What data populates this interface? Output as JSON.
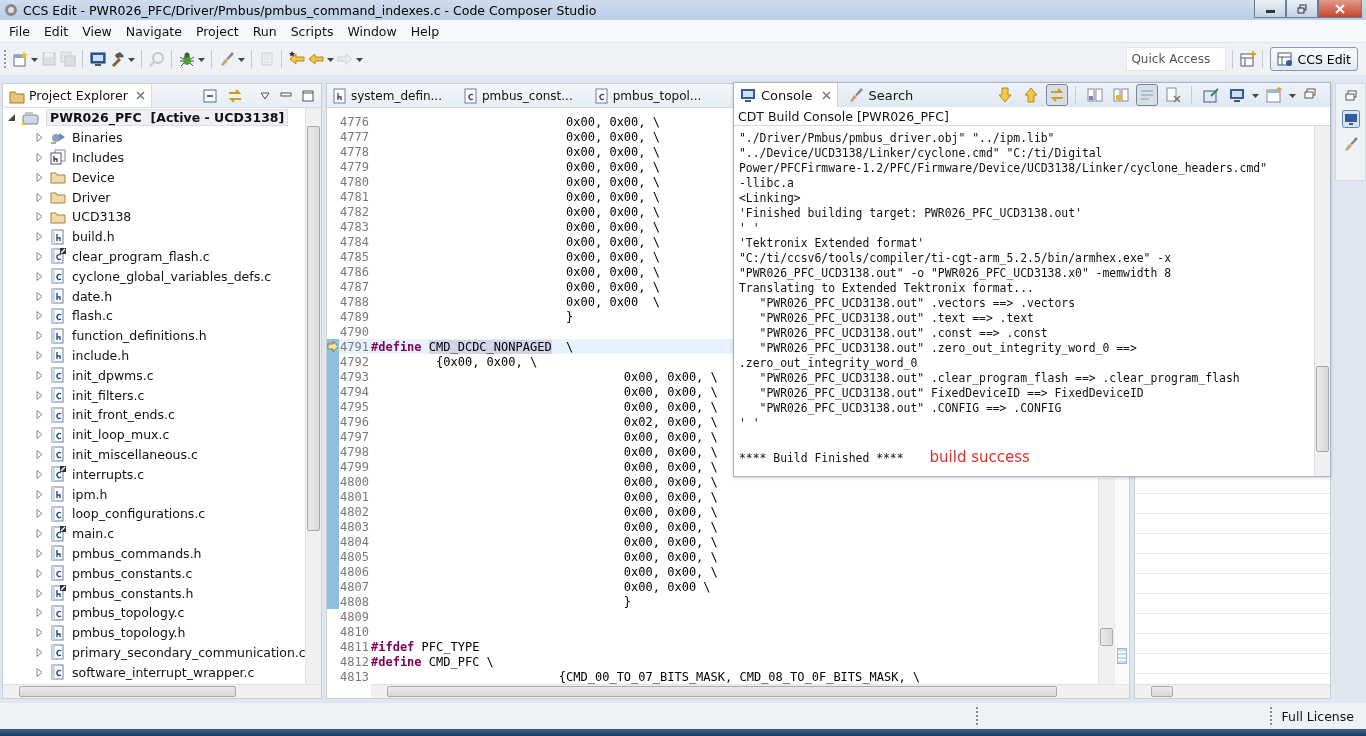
{
  "window": {
    "title": "CCS Edit - PWR026_PFC/Driver/Pmbus/pmbus_command_indexes.c - Code Composer Studio"
  },
  "menu": [
    "File",
    "Edit",
    "View",
    "Navigate",
    "Project",
    "Run",
    "Scripts",
    "Window",
    "Help"
  ],
  "toolbar": {
    "items": [
      {
        "kind": "new",
        "disabled": false,
        "dropdown": true
      },
      {
        "kind": "save",
        "disabled": true,
        "dropdown": false
      },
      {
        "kind": "save-all",
        "disabled": true,
        "dropdown": false
      },
      {
        "kind": "sep"
      },
      {
        "kind": "monitor",
        "disabled": false,
        "dropdown": false
      },
      {
        "kind": "hammer",
        "disabled": false,
        "dropdown": true
      },
      {
        "kind": "sep"
      },
      {
        "kind": "search",
        "disabled": true,
        "dropdown": false
      },
      {
        "kind": "sep"
      },
      {
        "kind": "bug",
        "disabled": false,
        "dropdown": true
      },
      {
        "kind": "sep"
      },
      {
        "kind": "brush",
        "disabled": false,
        "dropdown": true
      },
      {
        "kind": "sep"
      },
      {
        "kind": "page",
        "disabled": true,
        "dropdown": false
      },
      {
        "kind": "sep"
      },
      {
        "kind": "last-edit",
        "disabled": false,
        "dropdown": false
      },
      {
        "kind": "back",
        "disabled": false,
        "dropdown": true
      },
      {
        "kind": "forward",
        "disabled": true,
        "dropdown": true
      }
    ],
    "quick_access": {
      "placeholder": "Quick Access"
    },
    "perspective": {
      "label": "CCS Edit",
      "selected": true
    }
  },
  "project_explorer": {
    "title": "Project Explorer",
    "tree": {
      "label": "PWR026_PFC  [Active - UCD3138]",
      "expanded": true,
      "selected": true,
      "children": [
        {
          "label": "Binaries",
          "kind": "binaries",
          "expanded": false,
          "linked": false
        },
        {
          "label": "Includes",
          "kind": "includes",
          "expanded": false,
          "linked": false
        },
        {
          "label": "Device",
          "kind": "folder",
          "expanded": false,
          "linked": false
        },
        {
          "label": "Driver",
          "kind": "folder",
          "expanded": false,
          "linked": false
        },
        {
          "label": "UCD3138",
          "kind": "folder",
          "expanded": false,
          "linked": false
        },
        {
          "label": "build.h",
          "kind": "h",
          "expanded": false,
          "linked": false
        },
        {
          "label": "clear_program_flash.c",
          "kind": "c",
          "expanded": false,
          "linked": true
        },
        {
          "label": "cyclone_global_variables_defs.c",
          "kind": "c",
          "expanded": false,
          "linked": false
        },
        {
          "label": "date.h",
          "kind": "h",
          "expanded": false,
          "linked": false
        },
        {
          "label": "flash.c",
          "kind": "c",
          "expanded": false,
          "linked": false
        },
        {
          "label": "function_definitions.h",
          "kind": "h",
          "expanded": false,
          "linked": false
        },
        {
          "label": "include.h",
          "kind": "h",
          "expanded": false,
          "linked": false
        },
        {
          "label": "init_dpwms.c",
          "kind": "c",
          "expanded": false,
          "linked": false
        },
        {
          "label": "init_filters.c",
          "kind": "c",
          "expanded": false,
          "linked": false
        },
        {
          "label": "init_front_ends.c",
          "kind": "c",
          "expanded": false,
          "linked": false
        },
        {
          "label": "init_loop_mux.c",
          "kind": "c",
          "expanded": false,
          "linked": false
        },
        {
          "label": "init_miscellaneous.c",
          "kind": "c",
          "expanded": false,
          "linked": false
        },
        {
          "label": "interrupts.c",
          "kind": "c",
          "expanded": false,
          "linked": true
        },
        {
          "label": "ipm.h",
          "kind": "h",
          "expanded": false,
          "linked": false
        },
        {
          "label": "loop_configurations.c",
          "kind": "c",
          "expanded": false,
          "linked": false
        },
        {
          "label": "main.c",
          "kind": "c",
          "expanded": false,
          "linked": true
        },
        {
          "label": "pmbus_commands.h",
          "kind": "h",
          "expanded": false,
          "linked": false
        },
        {
          "label": "pmbus_constants.c",
          "kind": "c",
          "expanded": false,
          "linked": false
        },
        {
          "label": "pmbus_constants.h",
          "kind": "h",
          "expanded": false,
          "linked": true
        },
        {
          "label": "pmbus_topology.c",
          "kind": "c",
          "expanded": false,
          "linked": false
        },
        {
          "label": "pmbus_topology.h",
          "kind": "h",
          "expanded": false,
          "linked": false
        },
        {
          "label": "primary_secondary_communication.c",
          "kind": "c",
          "expanded": false,
          "linked": false
        },
        {
          "label": "software_interrupt_wrapper.c",
          "kind": "c",
          "expanded": false,
          "linked": false
        }
      ]
    }
  },
  "editor": {
    "tabs": [
      {
        "label": "system_defin...",
        "kind": "h",
        "selected": false
      },
      {
        "label": "pmbus_const...",
        "kind": "c",
        "selected": false
      },
      {
        "label": "pmbus_topol...",
        "kind": "c",
        "selected": false
      }
    ],
    "lines": [
      {
        "number": "4776",
        "marked": false,
        "current": false,
        "parts": [
          {
            "kind": "plain",
            "text": "                           0x00, 0x00, \\"
          }
        ]
      },
      {
        "number": "4777",
        "marked": false,
        "current": false,
        "parts": [
          {
            "kind": "plain",
            "text": "                           0x00, 0x00, \\"
          }
        ]
      },
      {
        "number": "4778",
        "marked": false,
        "current": false,
        "parts": [
          {
            "kind": "plain",
            "text": "                           0x00, 0x00, \\"
          }
        ]
      },
      {
        "number": "4779",
        "marked": false,
        "current": false,
        "parts": [
          {
            "kind": "plain",
            "text": "                           0x00, 0x00, \\"
          }
        ]
      },
      {
        "number": "4780",
        "marked": false,
        "current": false,
        "parts": [
          {
            "kind": "plain",
            "text": "                           0x00, 0x00, \\"
          }
        ]
      },
      {
        "number": "4781",
        "marked": false,
        "current": false,
        "parts": [
          {
            "kind": "plain",
            "text": "                           0x00, 0x00, \\"
          }
        ]
      },
      {
        "number": "4782",
        "marked": false,
        "current": false,
        "parts": [
          {
            "kind": "plain",
            "text": "                           0x00, 0x00, \\"
          }
        ]
      },
      {
        "number": "4783",
        "marked": false,
        "current": false,
        "parts": [
          {
            "kind": "plain",
            "text": "                           0x00, 0x00, \\"
          }
        ]
      },
      {
        "number": "4784",
        "marked": false,
        "current": false,
        "parts": [
          {
            "kind": "plain",
            "text": "                           0x00, 0x00, \\"
          }
        ]
      },
      {
        "number": "4785",
        "marked": false,
        "current": false,
        "parts": [
          {
            "kind": "plain",
            "text": "                           0x00, 0x00, \\"
          }
        ]
      },
      {
        "number": "4786",
        "marked": false,
        "current": false,
        "parts": [
          {
            "kind": "plain",
            "text": "                           0x00, 0x00, \\"
          }
        ]
      },
      {
        "number": "4787",
        "marked": false,
        "current": false,
        "parts": [
          {
            "kind": "plain",
            "text": "                           0x00, 0x00, \\"
          }
        ]
      },
      {
        "number": "4788",
        "marked": false,
        "current": false,
        "parts": [
          {
            "kind": "plain",
            "text": "                           0x00, 0x00  \\"
          }
        ]
      },
      {
        "number": "4789",
        "marked": false,
        "current": false,
        "parts": [
          {
            "kind": "plain",
            "text": "                           }"
          }
        ]
      },
      {
        "number": "4790",
        "marked": false,
        "current": false
      },
      {
        "number": "4791",
        "marked": true,
        "current": true,
        "parts": [
          {
            "kind": "keyword",
            "text": "#define "
          },
          {
            "kind": "occurrence",
            "text": "CMD_DCDC_NONPAGED"
          },
          {
            "kind": "plain",
            "text": "  \\"
          }
        ]
      },
      {
        "number": "4792",
        "marked": true,
        "current": false,
        "parts": [
          {
            "kind": "plain",
            "text": "         {0x00, 0x00, \\"
          }
        ]
      },
      {
        "number": "4793",
        "marked": true,
        "current": false,
        "parts": [
          {
            "kind": "plain",
            "text": "                                   0x00, 0x00, \\"
          }
        ]
      },
      {
        "number": "4794",
        "marked": true,
        "current": false,
        "parts": [
          {
            "kind": "plain",
            "text": "                                   0x00, 0x00, \\"
          }
        ]
      },
      {
        "number": "4795",
        "marked": true,
        "current": false,
        "parts": [
          {
            "kind": "plain",
            "text": "                                   0x00, 0x00, \\"
          }
        ]
      },
      {
        "number": "4796",
        "marked": true,
        "current": false,
        "parts": [
          {
            "kind": "plain",
            "text": "                                   0x02, 0x00, \\"
          }
        ]
      },
      {
        "number": "4797",
        "marked": true,
        "current": false,
        "parts": [
          {
            "kind": "plain",
            "text": "                                   0x00, 0x00, \\"
          }
        ]
      },
      {
        "number": "4798",
        "marked": true,
        "current": false,
        "parts": [
          {
            "kind": "plain",
            "text": "                                   0x00, 0x00, \\"
          }
        ]
      },
      {
        "number": "4799",
        "marked": true,
        "current": false,
        "parts": [
          {
            "kind": "plain",
            "text": "                                   0x00, 0x00, \\"
          }
        ]
      },
      {
        "number": "4800",
        "marked": true,
        "current": false,
        "parts": [
          {
            "kind": "plain",
            "text": "                                   0x00, 0x00, \\"
          }
        ]
      },
      {
        "number": "4801",
        "marked": true,
        "current": false,
        "parts": [
          {
            "kind": "plain",
            "text": "                                   0x00, 0x00, \\"
          }
        ]
      },
      {
        "number": "4802",
        "marked": true,
        "current": false,
        "parts": [
          {
            "kind": "plain",
            "text": "                                   0x00, 0x00, \\"
          }
        ]
      },
      {
        "number": "4803",
        "marked": true,
        "current": false,
        "parts": [
          {
            "kind": "plain",
            "text": "                                   0x00, 0x00, \\"
          }
        ]
      },
      {
        "number": "4804",
        "marked": true,
        "current": false,
        "parts": [
          {
            "kind": "plain",
            "text": "                                   0x00, 0x00, \\"
          }
        ]
      },
      {
        "number": "4805",
        "marked": true,
        "current": false,
        "parts": [
          {
            "kind": "plain",
            "text": "                                   0x00, 0x00, \\"
          }
        ]
      },
      {
        "number": "4806",
        "marked": true,
        "current": false,
        "parts": [
          {
            "kind": "plain",
            "text": "                                   0x00, 0x00, \\"
          }
        ]
      },
      {
        "number": "4807",
        "marked": true,
        "current": false,
        "parts": [
          {
            "kind": "plain",
            "text": "                                   0x00, 0x00 \\"
          }
        ]
      },
      {
        "number": "4808",
        "marked": true,
        "current": false,
        "parts": [
          {
            "kind": "plain",
            "text": "                                   }"
          }
        ]
      },
      {
        "number": "4809",
        "marked": false,
        "current": false
      },
      {
        "number": "4810",
        "marked": false,
        "current": false
      },
      {
        "number": "4811",
        "marked": false,
        "current": false,
        "parts": [
          {
            "kind": "keyword",
            "text": "#ifdef"
          },
          {
            "kind": "plain",
            "text": " PFC_TYPE"
          }
        ]
      },
      {
        "number": "4812",
        "marked": false,
        "current": false,
        "parts": [
          {
            "kind": "keyword",
            "text": "#define"
          },
          {
            "kind": "plain",
            "text": " CMD_PFC \\"
          }
        ]
      },
      {
        "number": "4813",
        "marked": false,
        "current": false,
        "parts": [
          {
            "kind": "plain",
            "text": "                          {CMD_00_TO_07_BITS_MASK, CMD_08_TO_0F_BITS_MASK, \\"
          }
        ]
      }
    ]
  },
  "console": {
    "tabs": [
      {
        "label": "Console",
        "selected": true
      },
      {
        "label": "Search",
        "selected": false
      }
    ],
    "tools": [
      {
        "kind": "down",
        "pressed": false
      },
      {
        "kind": "up",
        "pressed": false
      },
      {
        "kind": "link",
        "pressed": true
      },
      {
        "kind": "sep"
      },
      {
        "kind": "columns",
        "pressed": false
      },
      {
        "kind": "lock",
        "pressed": false
      },
      {
        "kind": "wrap",
        "pressed": true
      },
      {
        "kind": "clear",
        "pressed": false
      },
      {
        "kind": "sep"
      },
      {
        "kind": "pin",
        "pressed": false
      },
      {
        "kind": "display",
        "pressed": false
      },
      {
        "kind": "caret"
      },
      {
        "kind": "new-window",
        "pressed": false
      },
      {
        "kind": "caret"
      },
      {
        "kind": "restore",
        "pressed": false
      }
    ],
    "subtitle": "CDT Build Console [PWR026_PFC]",
    "lines": [
      "\"./Driver/Pmbus/pmbus_driver.obj\" \"../ipm.lib\"",
      "\"../Device/UCD3138/Linker/cyclone.cmd\" \"C:/ti/Digital",
      "Power/PFCFirmware-1.2/PFC/Firmware/Device/UCD3138/Linker/cyclone_headers.cmd\"",
      "-llibc.a",
      "<Linking>",
      "'Finished building target: PWR026_PFC_UCD3138.out'",
      "' '",
      "'Tektronix Extended format'",
      "\"C:/ti/ccsv6/tools/compiler/ti-cgt-arm_5.2.5/bin/armhex.exe\" -x",
      "\"PWR026_PFC_UCD3138.out\" -o \"PWR026_PFC_UCD3138.x0\" -memwidth 8",
      "Translating to Extended Tektronix format...",
      "   \"PWR026_PFC_UCD3138.out\" .vectors ==> .vectors",
      "   \"PWR026_PFC_UCD3138.out\" .text ==> .text",
      "   \"PWR026_PFC_UCD3138.out\" .const ==> .const",
      "   \"PWR026_PFC_UCD3138.out\" .zero_out_integrity_word_0 ==>",
      ".zero_out_integrity_word_0",
      "   \"PWR026_PFC_UCD3138.out\" .clear_program_flash ==> .clear_program_flash",
      "   \"PWR026_PFC_UCD3138.out\" FixedDeviceID ==> FixedDeviceID",
      "   \"PWR026_PFC_UCD3138.out\" .CONFIG ==> .CONFIG",
      "' '"
    ],
    "finished": "**** Build Finished ****",
    "note": "build success"
  },
  "status_bar": {
    "license": "Full License"
  }
}
